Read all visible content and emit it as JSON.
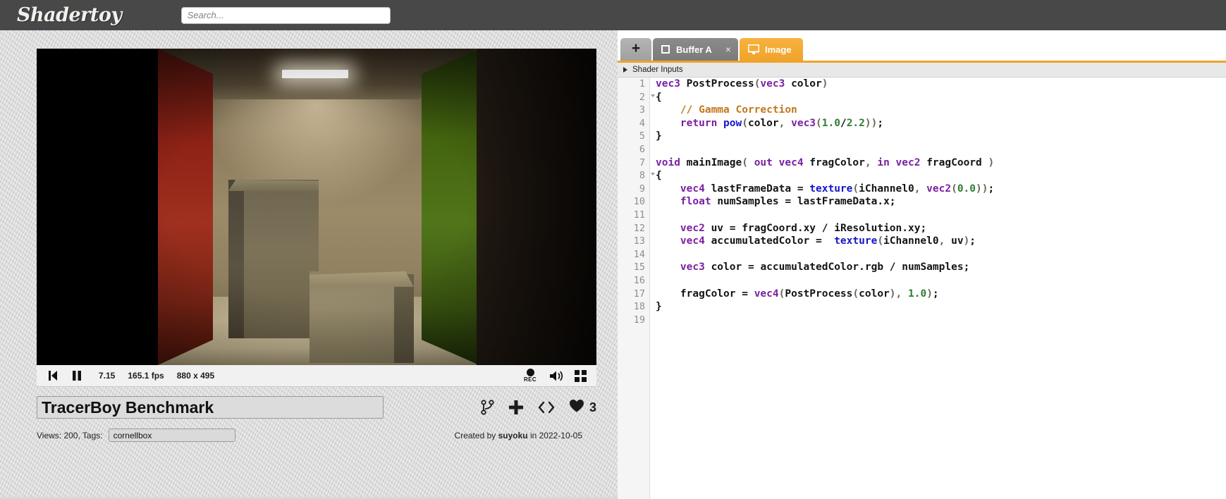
{
  "header": {
    "logo": "Shadertoy",
    "search_placeholder": "Search...",
    "search_value": ""
  },
  "player": {
    "rewind_icon": "skip-back-icon",
    "pause_icon": "pause-icon",
    "time": "7.15",
    "fps": "165.1 fps",
    "resolution": "880 x 495",
    "rec_label": "REC",
    "sound_icon": "speaker-icon",
    "fullscreen_icon": "fullscreen-icon"
  },
  "shader": {
    "title": "TracerBoy Benchmark",
    "views_label": "Views: 200, Tags:",
    "tag": "cornellbox",
    "credit_prefix": "Created by ",
    "author": "suyoku",
    "credit_suffix": " in 2022-10-05",
    "like_count": "3",
    "fork_icon": "fork-icon",
    "add_icon": "plus-icon",
    "embed_icon": "code-brackets-icon",
    "like_icon": "heart-icon"
  },
  "editor": {
    "add_tab_label": "+",
    "tabs": [
      {
        "label": "Buffer A",
        "icon": "square-icon",
        "close": "×",
        "active": false
      },
      {
        "label": "Image",
        "icon": "monitor-icon",
        "active": true
      }
    ],
    "inputs_label": "Shader Inputs",
    "line_numbers": [
      "1",
      "2",
      "3",
      "4",
      "5",
      "6",
      "7",
      "8",
      "9",
      "10",
      "11",
      "12",
      "13",
      "14",
      "15",
      "16",
      "17",
      "18",
      "19"
    ],
    "fold_lines": [
      2,
      8
    ],
    "code": [
      "vec3 PostProcess(vec3 color)",
      "{",
      "    // Gamma Correction",
      "    return pow(color, vec3(1.0/2.2));",
      "}",
      "",
      "void mainImage( out vec4 fragColor, in vec2 fragCoord )",
      "{",
      "    vec4 lastFrameData = texture(iChannel0, vec2(0.0));",
      "    float numSamples = lastFrameData.x;",
      "",
      "    vec2 uv = fragCoord.xy / iResolution.xy;",
      "    vec4 accumulatedColor =  texture(iChannel0, uv);",
      "",
      "    vec3 color = accumulatedColor.rgb / numSamples;",
      "",
      "    fragColor = vec4(PostProcess(color), 1.0);",
      "}",
      ""
    ]
  },
  "colors": {
    "header_bg": "#484848",
    "body_bg": "#d6d6d6",
    "accent_orange": "#f0a32b",
    "tab_inactive": "#7b7b7b",
    "keyword": "#7b1fa2",
    "builtin": "#1515c9",
    "number": "#2e7d32",
    "comment": "#c2761a"
  }
}
